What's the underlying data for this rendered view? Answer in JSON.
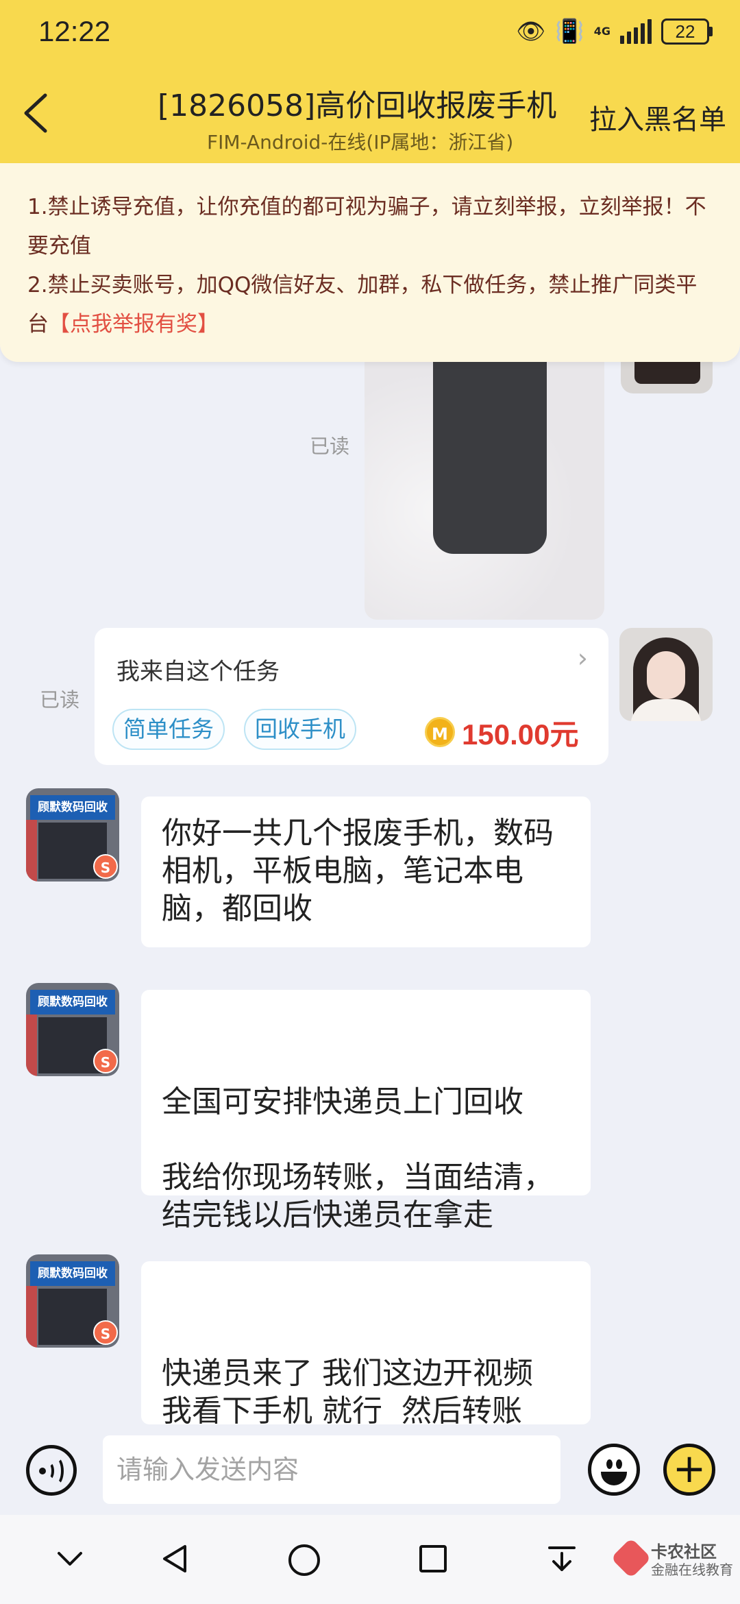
{
  "status_bar": {
    "time": "12:22",
    "network": "4G",
    "battery": "22"
  },
  "header": {
    "title": "[1826058]高价回收报废手机",
    "subtitle": "FIM-Android-在线(IP属地：浙江省)",
    "blacklist_label": "拉入黑名单",
    "background_color": "#f8d94e"
  },
  "notice": {
    "line1": "1.禁止诱导充值，让你充值的都可视为骗子，请立刻举报，立刻举报！不要充值",
    "line2": "2.禁止买卖账号，加QQ微信好友、加群，私下做任务，禁止推广同类平台",
    "report_link": "【点我举报有奖】"
  },
  "chat": {
    "read_label_1": "已读",
    "read_label_2": "已读",
    "task_card": {
      "from_text": "我来自这个任务",
      "tags": [
        "简单任务",
        "回收手机"
      ],
      "coin_symbol": "M",
      "price": "150.00元"
    },
    "shop_avatar": {
      "sign_text": "顾默数码回收",
      "badge": "S"
    },
    "messages": [
      {
        "text": "你好一共几个报废手机，数码相机，平板电脑，笔记本电脑，都回收"
      },
      {
        "text": "全国可安排快递员上门回收\n\n我给你现场转账，当面结清，结完钱以后快递员在拿走"
      },
      {
        "text": "快递员来了 我们这边开视频 我看下手机 就行  然后转账"
      }
    ]
  },
  "input_bar": {
    "placeholder": "请输入发送内容",
    "value": ""
  },
  "watermark": {
    "main": "卡农社区",
    "sub": "金融在线教育"
  }
}
